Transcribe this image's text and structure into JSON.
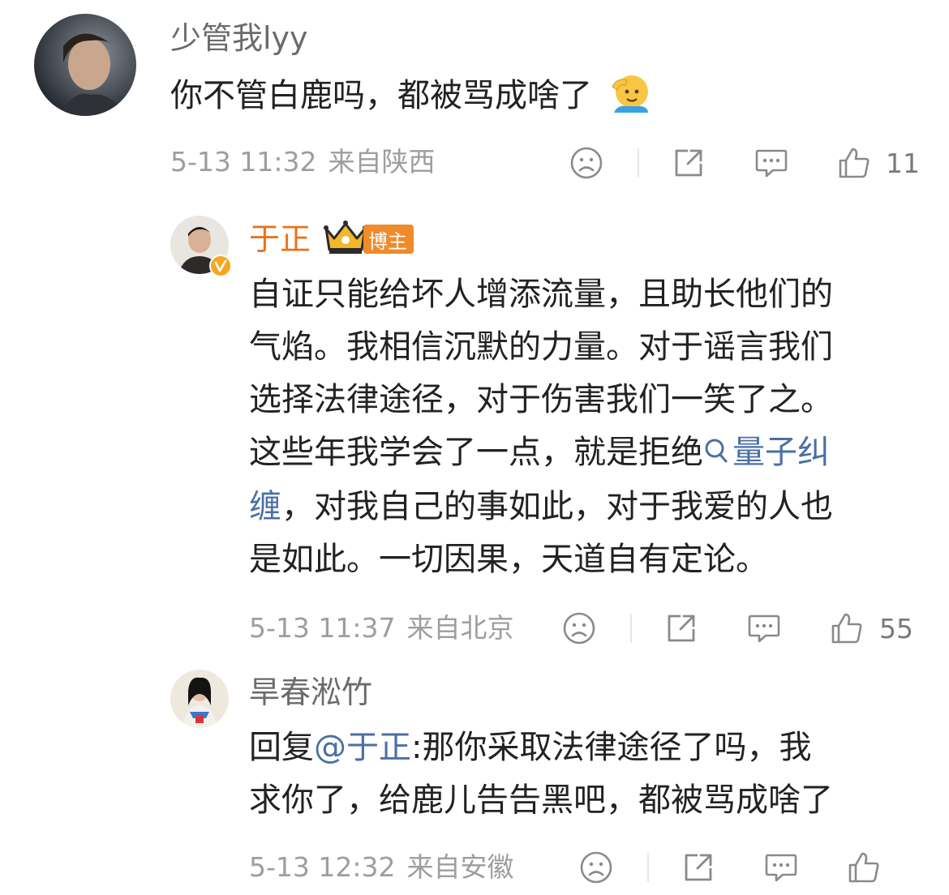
{
  "comments": [
    {
      "username": "少管我lyy",
      "text": "你不管白鹿吗，都被骂成啥了",
      "emoji": "🫡",
      "time": "5-13 11:32",
      "location": "来自陕西",
      "likes": "11"
    },
    {
      "username": "于正",
      "badge": "博主",
      "text_lines": [
        "自证只能给坏人增添流量，且助长他们的",
        "气焰。我相信沉默的力量。对于谣言我们",
        "选择法律途径，对于伤害我们一笑了之。"
      ],
      "text_line4_pre": "这些年我学会了一点，就是拒绝",
      "topic_link_a": "量子纠",
      "topic_link_b": "缠",
      "text_line5_post": "，对我自己的事如此，对于我爱的人也",
      "text_line6": "是如此。一切因果，天道自有定论。",
      "time": "5-13 11:37",
      "location": "来自北京",
      "likes": "55"
    },
    {
      "username": "旱春淞竹",
      "reply_prefix": "回复",
      "reply_mention": "@于正",
      "text_line1_rest": ":那你采取法律途径了吗，我",
      "text_line2": "求你了，给鹿儿告告黑吧，都被骂成啥了",
      "time": "5-13 12:32",
      "location": "来自安徽"
    }
  ],
  "colors": {
    "author_name": "#e8731a",
    "link": "#4a6fa5",
    "badge_bg": "#f08a2a",
    "verified": "#f5a623"
  }
}
